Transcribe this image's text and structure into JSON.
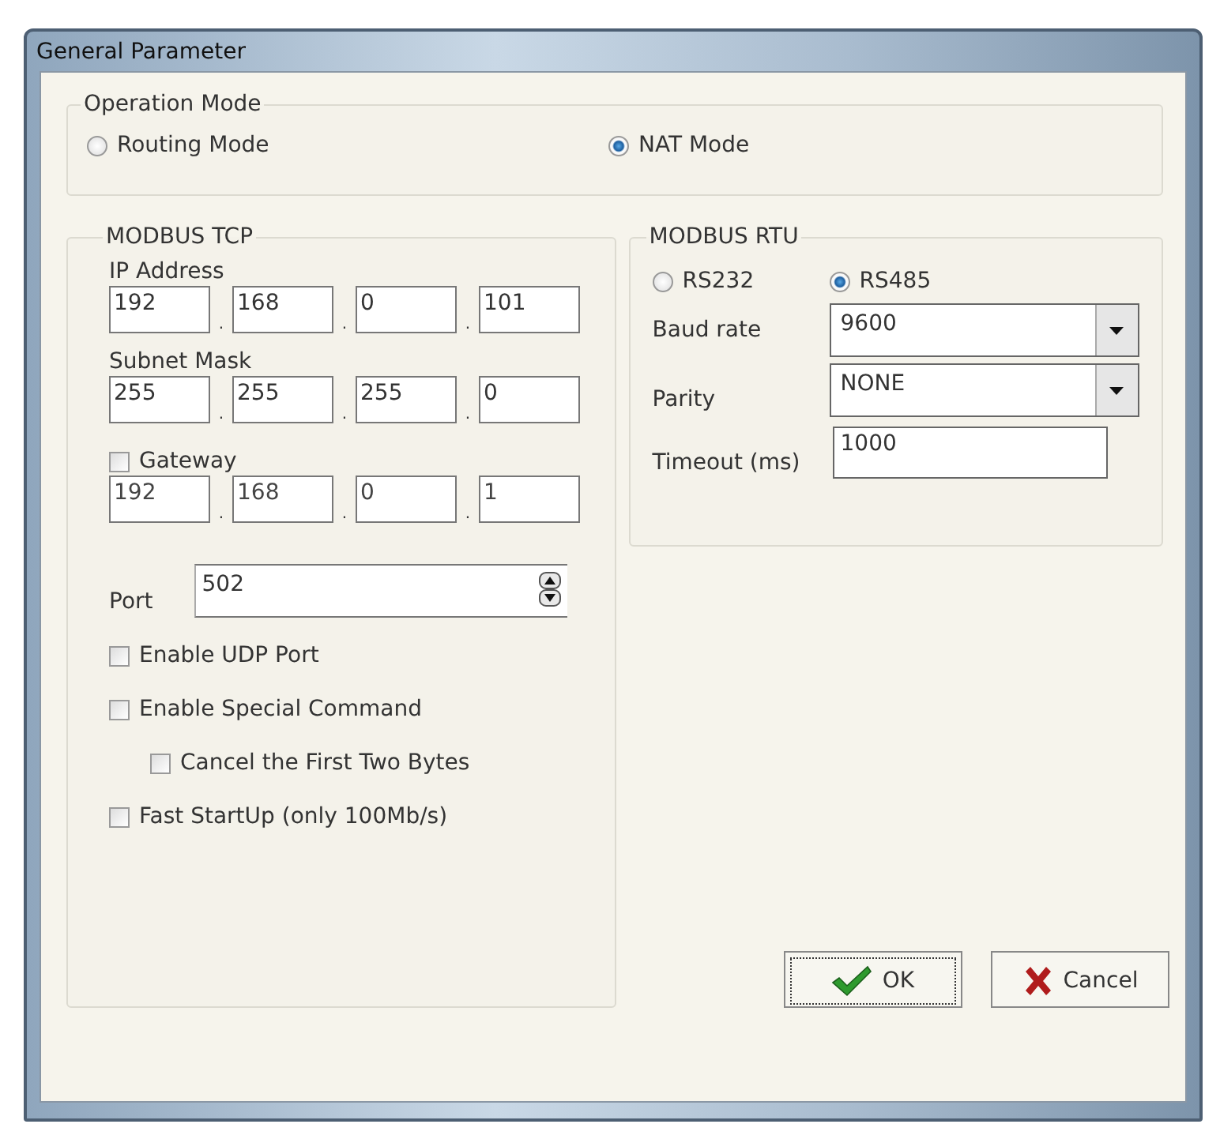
{
  "window": {
    "title": "General Parameter"
  },
  "operation_mode": {
    "title": "Operation Mode",
    "options": [
      {
        "label": "Routing Mode",
        "selected": false
      },
      {
        "label": "NAT Mode",
        "selected": true
      }
    ]
  },
  "modbus_tcp": {
    "title": "MODBUS TCP",
    "ip_address": {
      "label": "IP Address",
      "separator": ".",
      "octets": [
        "192",
        "168",
        "0",
        "101"
      ]
    },
    "subnet_mask": {
      "label": "Subnet Mask",
      "separator": ".",
      "octets": [
        "255",
        "255",
        "255",
        "0"
      ]
    },
    "gateway": {
      "label": "Gateway",
      "checked": false,
      "separator": ".",
      "octets": [
        "192",
        "168",
        "0",
        "1"
      ]
    },
    "port": {
      "label": "Port",
      "value": "502"
    },
    "options": [
      {
        "label": "Enable UDP Port",
        "checked": false
      },
      {
        "label": "Enable Special Command",
        "checked": false,
        "children": [
          {
            "label": "Cancel the First Two Bytes",
            "checked": false
          }
        ]
      },
      {
        "label": "Fast StartUp (only 100Mb/s)",
        "checked": false
      }
    ]
  },
  "modbus_rtu": {
    "title": "MODBUS RTU",
    "interfaces": [
      {
        "label": "RS232",
        "selected": false
      },
      {
        "label": "RS485",
        "selected": true
      }
    ],
    "baud_rate": {
      "label": "Baud rate",
      "value": "9600"
    },
    "parity": {
      "label": "Parity",
      "value": "NONE"
    },
    "timeout": {
      "label": "Timeout (ms)",
      "value": "1000"
    }
  },
  "buttons": [
    {
      "kind": "ok",
      "label": "OK",
      "focused": true
    },
    {
      "kind": "cancel",
      "label": "Cancel",
      "focused": false
    }
  ]
}
